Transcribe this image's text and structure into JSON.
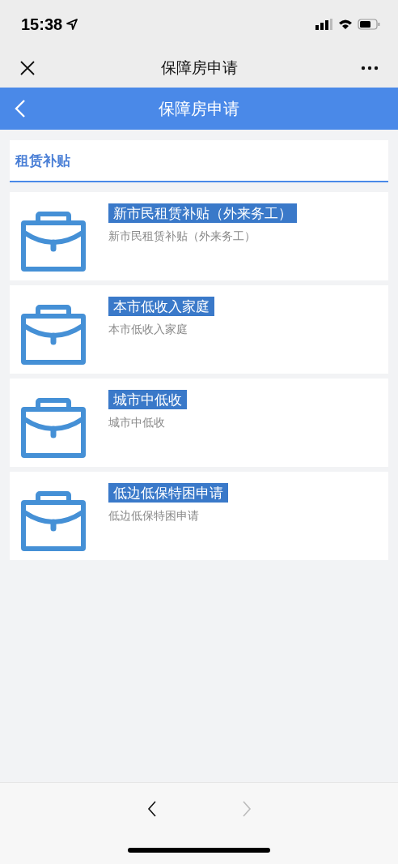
{
  "status_bar": {
    "time": "15:38"
  },
  "nav_bar": {
    "title": "保障房申请"
  },
  "header": {
    "title": "保障房申请"
  },
  "section": {
    "title": "租赁补贴"
  },
  "items": [
    {
      "title": "新市民租赁补贴（外来务工）",
      "subtitle": "新市民租赁补贴（外来务工）"
    },
    {
      "title": "本市低收入家庭",
      "subtitle": "本市低收入家庭"
    },
    {
      "title": "城市中低收",
      "subtitle": "城市中低收"
    },
    {
      "title": "低边低保特困申请",
      "subtitle": "低边低保特困申请"
    }
  ],
  "bottom_nav": {
    "back": {
      "disabled": false
    },
    "forward": {
      "disabled": true
    }
  }
}
